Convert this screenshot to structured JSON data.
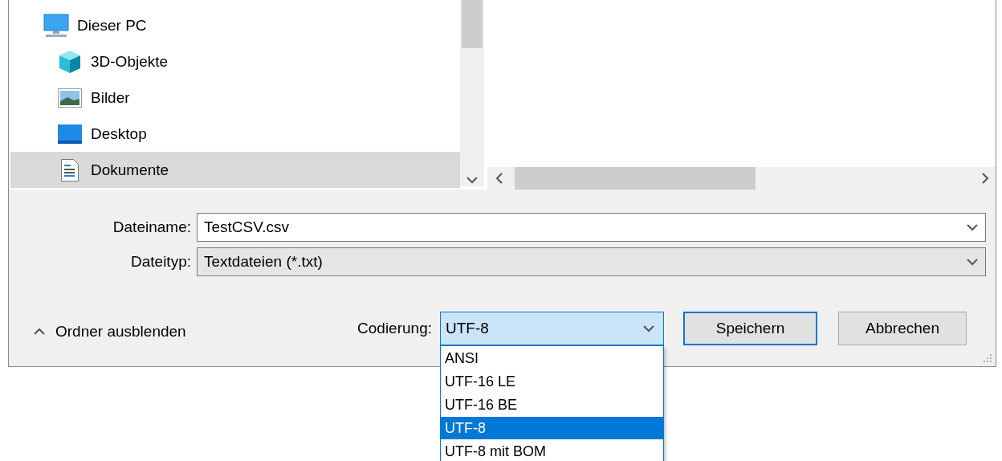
{
  "nav": {
    "items": [
      {
        "label": "Dieser PC",
        "kind": "computer",
        "selected": false,
        "children": [
          {
            "label": "3D-Objekte",
            "kind": "cube",
            "selected": false
          },
          {
            "label": "Bilder",
            "kind": "image",
            "selected": false
          },
          {
            "label": "Desktop",
            "kind": "desktop",
            "selected": false
          },
          {
            "label": "Dokumente",
            "kind": "document",
            "selected": true
          }
        ]
      }
    ]
  },
  "fields": [
    {
      "label": "Dateiname:",
      "value": "TestCSV.csv",
      "kind": "editable"
    },
    {
      "label": "Dateityp:",
      "value": "Textdateien (*.txt)",
      "kind": "readonly"
    }
  ],
  "footer": {
    "toggle": {
      "label": "Ordner ausblenden"
    },
    "encoding": {
      "label": "Codierung:",
      "value": "UTF-8",
      "expanded": true,
      "options": [
        {
          "label": "ANSI",
          "selected": false
        },
        {
          "label": "UTF-16 LE",
          "selected": false
        },
        {
          "label": "UTF-16 BE",
          "selected": false
        },
        {
          "label": "UTF-8",
          "selected": true
        },
        {
          "label": "UTF-8 mit BOM",
          "selected": false
        }
      ]
    },
    "buttons": [
      {
        "label": "Speichern",
        "default": true
      },
      {
        "label": "Abbrechen",
        "default": false
      }
    ]
  }
}
